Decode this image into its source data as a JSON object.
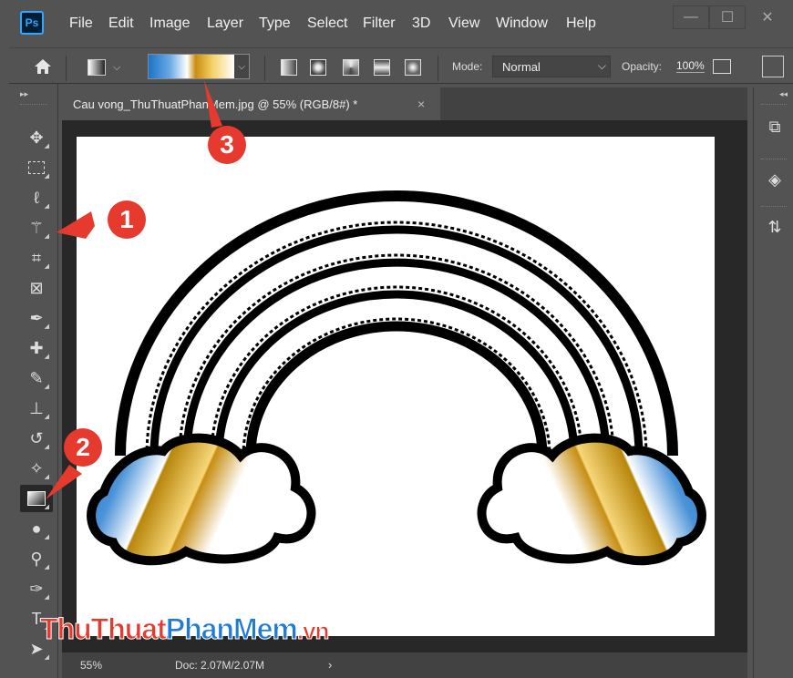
{
  "app": {
    "logo": "Ps"
  },
  "menu": [
    "File",
    "Edit",
    "Image",
    "Layer",
    "Type",
    "Select",
    "Filter",
    "3D",
    "View",
    "Window",
    "Help"
  ],
  "window_controls": {
    "minimize": "—",
    "maximize": "☐",
    "close": "✕"
  },
  "options_bar": {
    "mode_label": "Mode:",
    "mode_value": "Normal",
    "opacity_label": "Opacity:",
    "opacity_value": "100%"
  },
  "document_tab": {
    "title": "Cau vong_ThuThuatPhanMem.jpg @ 55% (RGB/8#) *",
    "close": "×"
  },
  "status_bar": {
    "zoom": "55%",
    "doc_info": "Doc: 2.07M/2.07M",
    "arrow": "›"
  },
  "annotations": [
    "1",
    "2",
    "3"
  ],
  "watermark": {
    "part1": "ThuThuat",
    "part2": "PhanMem",
    "part3": ".vn"
  },
  "colors": {
    "gradient_blue": "#1d73c4",
    "gradient_gold": "#c98d10",
    "badge_red": "#e63a2e",
    "ps_blue": "#31a8ff"
  },
  "tools": [
    "move-icon",
    "marquee-icon",
    "lasso-icon",
    "magic-wand-icon",
    "crop-icon",
    "frame-icon",
    "eyedropper-icon",
    "healing-brush-icon",
    "brush-icon",
    "clone-stamp-icon",
    "history-brush-icon",
    "eraser-icon",
    "gradient-icon",
    "blur-icon",
    "dodge-icon",
    "pen-icon",
    "type-icon",
    "path-selection-icon"
  ]
}
